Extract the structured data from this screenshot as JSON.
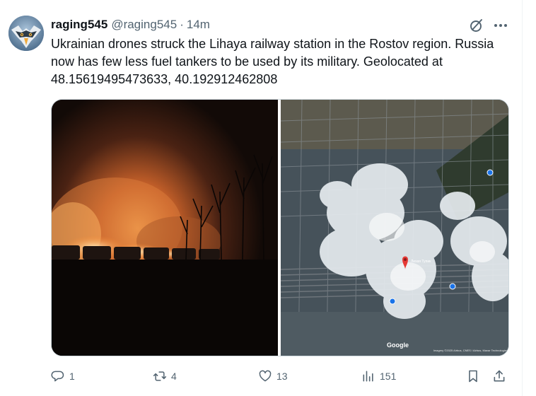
{
  "tweet": {
    "display_name": "raging545",
    "handle": "@raging545",
    "separator": "·",
    "time": "14m",
    "text": "Ukrainian drones struck the Lihaya railway station in the Rostov region. Russia now has few less fuel tankers to be used by its military. Geolocated at 48.15619495473633, 40.192912462808"
  },
  "media": {
    "map": {
      "google_label": "Google",
      "station_label": "Лихая Тупик",
      "attribution": "Imagery ©2025 Airbus, CNES / Airbus, Maxar Technologies"
    }
  },
  "actions": {
    "replies": "1",
    "reposts": "4",
    "likes": "13",
    "views": "151"
  },
  "icons": {
    "avatar": "eagle-avatar",
    "grok": "grok-icon",
    "more": "more-icon",
    "reply": "reply-icon",
    "repost": "repost-icon",
    "like": "heart-icon",
    "views": "views-icon",
    "bookmark": "bookmark-icon",
    "share": "share-icon"
  },
  "colors": {
    "secondary_text": "#536471",
    "border": "#cfd9de",
    "map_pin": "#e53935",
    "map_marker": "#1a73e8"
  }
}
